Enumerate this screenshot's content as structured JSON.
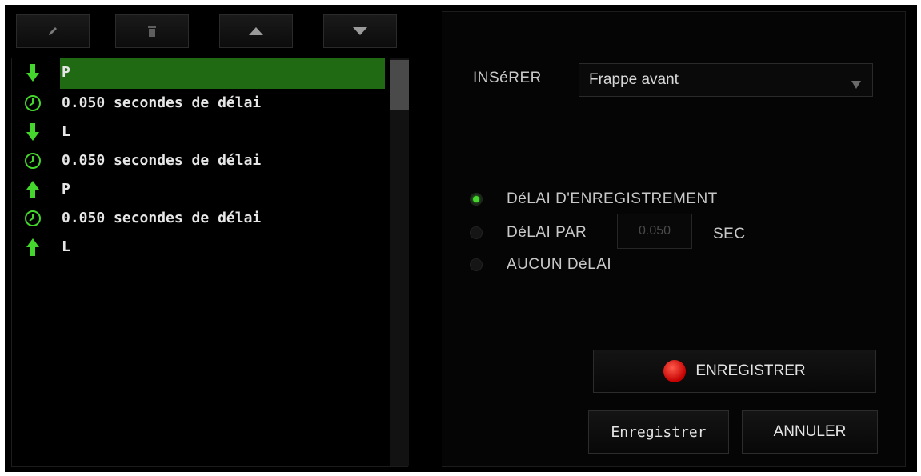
{
  "toolbar": {
    "edit_icon": "pencil-icon",
    "delete_icon": "trash-icon",
    "move_up_icon": "triangle-up-icon",
    "move_down_icon": "triangle-down-icon"
  },
  "macro_list": {
    "items": [
      {
        "icon": "arrow-down-icon",
        "text": "P",
        "selected": true
      },
      {
        "icon": "clock-icon",
        "text": "0.050 secondes de délai"
      },
      {
        "icon": "arrow-down-icon",
        "text": "L"
      },
      {
        "icon": "clock-icon",
        "text": "0.050 secondes de délai"
      },
      {
        "icon": "arrow-up-icon",
        "text": "P"
      },
      {
        "icon": "clock-icon",
        "text": "0.050 secondes de délai"
      },
      {
        "icon": "arrow-up-icon",
        "text": "L"
      }
    ]
  },
  "insert": {
    "label": "INSéRER",
    "selected_value": "Frappe avant"
  },
  "delay_options": {
    "record_delay": "DéLAI D'ENREGISTREMENT",
    "fixed_delay": "DéLAI PAR",
    "fixed_delay_value": "0.050",
    "fixed_delay_unit": "SEC",
    "no_delay": "AUCUN DéLAI",
    "selected": "record_delay"
  },
  "buttons": {
    "record": "ENREGISTRER",
    "save": "Enregistrer",
    "cancel": "ANNULER"
  },
  "colors": {
    "accent_green": "#44d62c",
    "selection_green": "#1f6a12",
    "record_red": "#d40000"
  }
}
